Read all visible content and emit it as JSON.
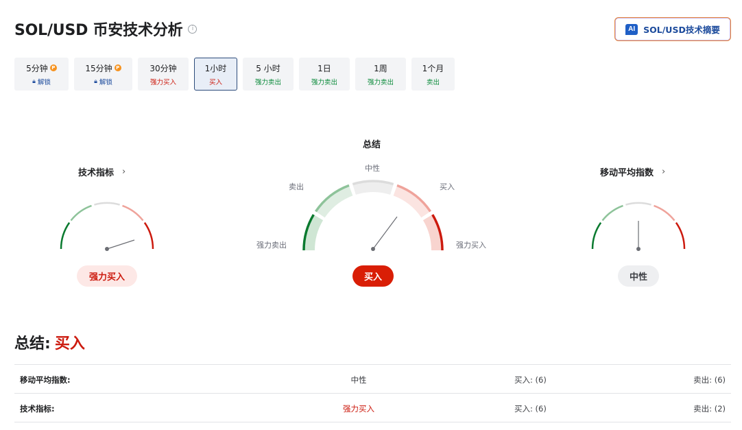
{
  "header": {
    "title": "SOL/USD 币安技术分析",
    "info": "i",
    "ai_button": {
      "badge": "AI",
      "label": "SOL/USD技术摘要"
    }
  },
  "timeframes": [
    {
      "label": "5分钟",
      "sub": "解锁",
      "locked": true,
      "active": false
    },
    {
      "label": "15分钟",
      "sub": "解锁",
      "locked": true,
      "active": false
    },
    {
      "label": "30分钟",
      "sub": "强力买入",
      "active": false
    },
    {
      "label": "1小时",
      "sub": "买入",
      "active": true
    },
    {
      "label": "5 小时",
      "sub": "强力卖出",
      "active": false
    },
    {
      "label": "1日",
      "sub": "强力卖出",
      "active": false
    },
    {
      "label": "1周",
      "sub": "强力卖出",
      "active": false
    },
    {
      "label": "1个月",
      "sub": "卖出",
      "active": false
    }
  ],
  "gauges": {
    "technical": {
      "title": "技术指标",
      "result": "强力买入",
      "chevron": "›"
    },
    "summary": {
      "title": "总结",
      "result": "买入",
      "labels": {
        "neutral": "中性",
        "sell": "卖出",
        "buy": "买入",
        "strong_sell": "强力卖出",
        "strong_buy": "强力买入"
      }
    },
    "moving_averages": {
      "title": "移动平均指数",
      "result": "中性",
      "chevron": "›"
    }
  },
  "summary": {
    "label": "总结:",
    "value": "买入",
    "rows": [
      {
        "name": "移动平均指数:",
        "result": "中性",
        "buy": "买入: (6)",
        "sell": "卖出: (6)"
      },
      {
        "name": "技术指标:",
        "result": "强力买入",
        "buy": "买入: (6)",
        "sell": "卖出: (2)"
      }
    ]
  },
  "colors": {
    "strong_sell": "#0a7a2f",
    "sell": "#8ec39a",
    "neutral": "#dcdcdc",
    "buy": "#efa39b",
    "strong_buy": "#cc1a0e",
    "ai_border": "#e9883b",
    "brand_blue": "#1b4a9c"
  }
}
